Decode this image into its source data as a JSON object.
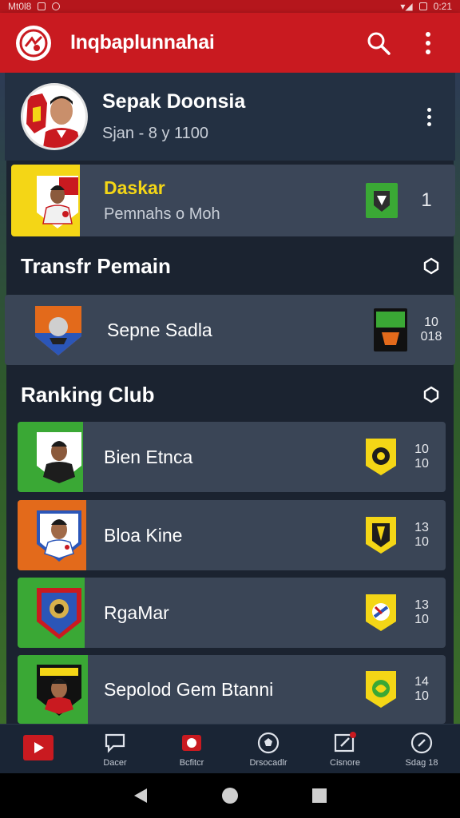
{
  "status_bar": {
    "left_text": "Mt0l8",
    "time": "0:21"
  },
  "app_bar": {
    "title": "Inqbaplunnahai",
    "search_icon": "search-icon",
    "menu_icon": "more-vert-icon"
  },
  "profile": {
    "name": "Sepak Doonsia",
    "subtitle": "Sjan - 8 y 1100"
  },
  "highlight": {
    "name": "Daskar",
    "subtitle": "Pemnahs o Moh",
    "count": "1",
    "accent": "#f4d616"
  },
  "transfer": {
    "title": "Transfr Pemain",
    "rows": [
      {
        "name": "Sepne Sadla",
        "stat1": "10",
        "stat2": "018"
      }
    ]
  },
  "ranking": {
    "title": "Ranking Club",
    "rows": [
      {
        "name": "Bien Etnca",
        "stat1": "10",
        "stat2": "10",
        "accent": "#3aa835"
      },
      {
        "name": "Bloa Kine",
        "stat1": "13",
        "stat2": "10",
        "accent": "#e36a1b"
      },
      {
        "name": "RgaMar",
        "stat1": "13",
        "stat2": "10",
        "accent": "#3aa835"
      },
      {
        "name": "Sepolod Gem Btanni",
        "stat1": "14",
        "stat2": "10",
        "accent": "#3aa835"
      }
    ]
  },
  "bottom_nav": [
    {
      "label": "",
      "icon": "play-icon"
    },
    {
      "label": "Dacer",
      "icon": "chat-icon"
    },
    {
      "label": "Bcfitcr",
      "icon": "trophy-icon"
    },
    {
      "label": "Drsocadlr",
      "icon": "ball-icon"
    },
    {
      "label": "Cisnore",
      "icon": "edit-icon"
    },
    {
      "label": "Sdag 18",
      "icon": "compass-icon"
    }
  ],
  "colors": {
    "brand_red": "#c91a20",
    "background": "#1b2330",
    "card": "#3a4556"
  }
}
